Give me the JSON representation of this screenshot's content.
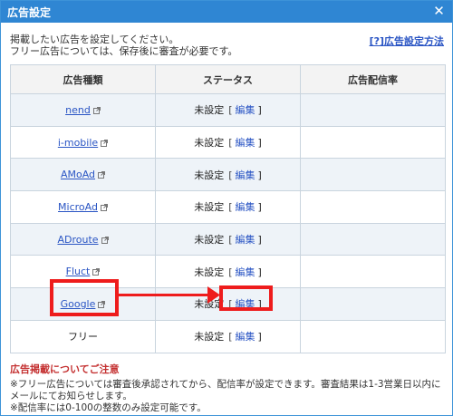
{
  "window": {
    "title": "広告設定",
    "close_label": "✕"
  },
  "intro": {
    "line1": "掲載したい広告を設定してください。",
    "line2": "フリー広告については、保存後に審査が必要です。"
  },
  "help_link": "[?]広告設定方法",
  "table": {
    "headers": [
      "広告種類",
      "ステータス",
      "広告配信率"
    ],
    "rows": [
      {
        "name": "nend",
        "status": "未設定",
        "edit": "編集",
        "rate": ""
      },
      {
        "name": "i-mobile",
        "status": "未設定",
        "edit": "編集",
        "rate": ""
      },
      {
        "name": "AMoAd",
        "status": "未設定",
        "edit": "編集",
        "rate": ""
      },
      {
        "name": "MicroAd",
        "status": "未設定",
        "edit": "編集",
        "rate": ""
      },
      {
        "name": "ADroute",
        "status": "未設定",
        "edit": "編集",
        "rate": ""
      },
      {
        "name": "Fluct",
        "status": "未設定",
        "edit": "編集",
        "rate": ""
      },
      {
        "name": "Google",
        "status": "未設定",
        "edit": "編集",
        "rate": ""
      },
      {
        "name": "フリー",
        "status": "未設定",
        "edit": "編集",
        "rate": ""
      }
    ]
  },
  "notes": {
    "heading": "広告掲載についてご注意",
    "lines": [
      "※フリー広告については審査後承認されてから、配信率が設定できます。審査結果は1-3営業日以内に",
      "メールにてお知らせします。",
      "※配信率には0-100の整数のみ設定可能です。"
    ]
  },
  "colors": {
    "title_bar": "#2f86d3",
    "link": "#2a55c4",
    "highlight": "#ee1c1c",
    "notice_heading": "#c43030"
  },
  "icons": {
    "external_link": "external-link-icon",
    "close": "close-icon"
  }
}
